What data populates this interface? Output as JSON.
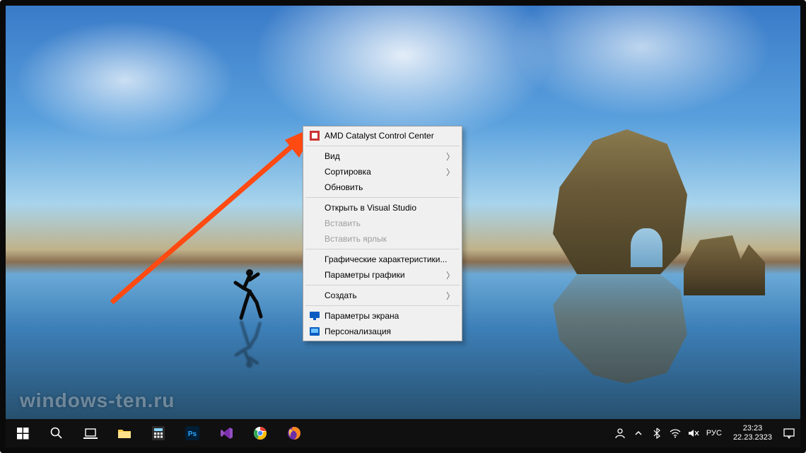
{
  "context_menu": {
    "items": [
      {
        "label": "AMD Catalyst Control Center",
        "icon": "amd-icon"
      },
      {
        "sep": true
      },
      {
        "label": "Вид",
        "submenu": true
      },
      {
        "label": "Сортировка",
        "submenu": true
      },
      {
        "label": "Обновить"
      },
      {
        "sep": true
      },
      {
        "label": "Открыть в Visual Studio"
      },
      {
        "label": "Вставить",
        "disabled": true
      },
      {
        "label": "Вставить ярлык",
        "disabled": true
      },
      {
        "sep": true
      },
      {
        "label": "Графические характеристики..."
      },
      {
        "label": "Параметры графики",
        "submenu": true
      },
      {
        "sep": true
      },
      {
        "label": "Создать",
        "submenu": true
      },
      {
        "sep": true
      },
      {
        "label": "Параметры экрана",
        "icon": "display-icon"
      },
      {
        "label": "Персонализация",
        "icon": "personalize-icon"
      }
    ]
  },
  "taskbar": {
    "apps": [
      {
        "name": "start",
        "icon": "windows-icon"
      },
      {
        "name": "search",
        "icon": "search-icon"
      },
      {
        "name": "task-view",
        "icon": "task-view-icon"
      },
      {
        "name": "explorer",
        "icon": "explorer-icon"
      },
      {
        "name": "calculator",
        "icon": "calculator-icon"
      },
      {
        "name": "photoshop",
        "icon": "photoshop-icon"
      },
      {
        "name": "visual-studio",
        "icon": "visual-studio-icon"
      },
      {
        "name": "chrome",
        "icon": "chrome-icon"
      },
      {
        "name": "firefox",
        "icon": "firefox-icon"
      }
    ],
    "tray": {
      "people": "people-icon",
      "chevron": "chevron-up-icon",
      "wifi": "wifi-icon",
      "volume": "volume-mute-icon",
      "language": "РУС",
      "time": "23:23",
      "date": "22.23.2323",
      "notifications": "notification-icon"
    }
  },
  "watermark": "windows-ten.ru"
}
